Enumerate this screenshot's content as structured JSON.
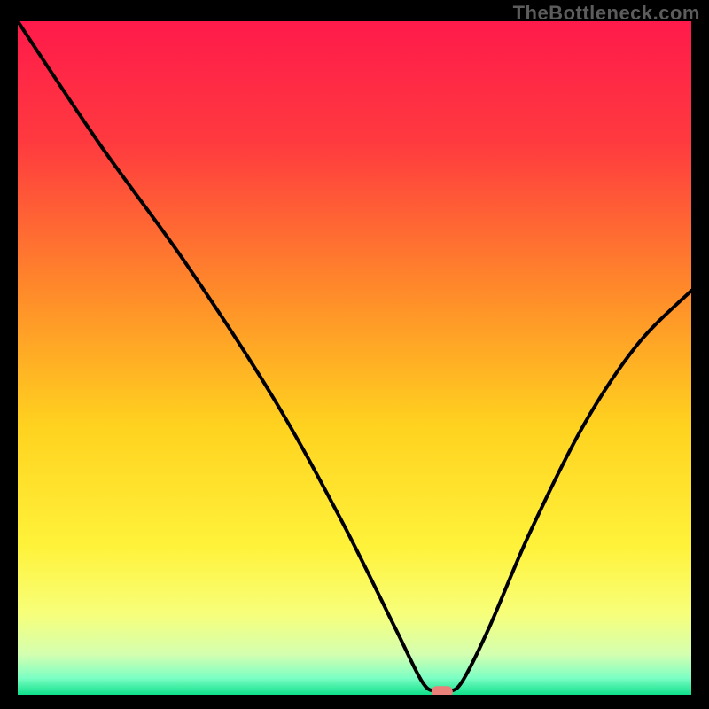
{
  "watermark": "TheBottleneck.com",
  "chart_data": {
    "type": "line",
    "title": "",
    "xlabel": "",
    "ylabel": "",
    "xlim": [
      0,
      100
    ],
    "ylim": [
      0,
      100
    ],
    "x": [
      0,
      12,
      25,
      38,
      48,
      56,
      60,
      62,
      64,
      66,
      70,
      76,
      84,
      92,
      100
    ],
    "y": [
      100,
      82,
      64,
      44,
      26,
      10,
      2,
      0.5,
      0.5,
      2,
      10,
      24,
      40,
      52,
      60
    ],
    "minimum_marker": {
      "x": 63,
      "y": 0.5
    },
    "background_gradient_stops": [
      {
        "pos": 0.0,
        "color": "#ff1a4b"
      },
      {
        "pos": 0.18,
        "color": "#ff3a3f"
      },
      {
        "pos": 0.4,
        "color": "#ff8a2a"
      },
      {
        "pos": 0.6,
        "color": "#ffd21f"
      },
      {
        "pos": 0.78,
        "color": "#fff23a"
      },
      {
        "pos": 0.88,
        "color": "#f7ff7a"
      },
      {
        "pos": 0.94,
        "color": "#d4ffb0"
      },
      {
        "pos": 0.975,
        "color": "#7cffc4"
      },
      {
        "pos": 1.0,
        "color": "#0fe08a"
      }
    ],
    "marker_color": "#e9807a",
    "line_color": "#000000"
  }
}
